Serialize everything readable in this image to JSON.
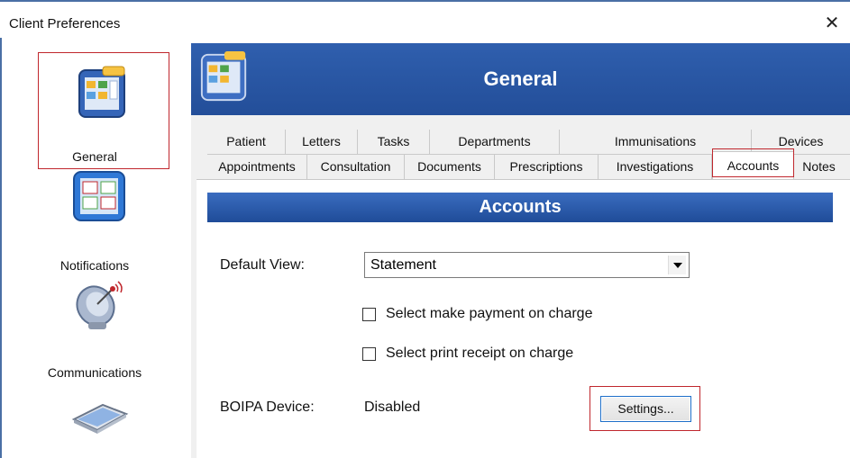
{
  "window": {
    "title": "Client Preferences",
    "close_glyph": "✕"
  },
  "sidebar": {
    "items": [
      {
        "label": "General",
        "icon": "general-app-icon",
        "selected": true
      },
      {
        "label": "Notifications",
        "icon": "notifications-board-icon"
      },
      {
        "label": "Communications",
        "icon": "satellite-dish-icon"
      },
      {
        "label": "",
        "icon": "scanner-icon"
      }
    ]
  },
  "header": {
    "title": "General"
  },
  "tabs": {
    "row1": [
      "Patient",
      "Letters",
      "Tasks",
      "Departments",
      "Immunisations",
      "Devices"
    ],
    "row2": [
      "Appointments",
      "Consultation",
      "Documents",
      "Prescriptions",
      "Investigations",
      "Accounts",
      "Notes"
    ],
    "active": "Accounts"
  },
  "accounts": {
    "title": "Accounts",
    "default_view_label": "Default View:",
    "default_view_value": "Statement",
    "chk_payment_label": "Select make payment on charge",
    "chk_payment_checked": false,
    "chk_receipt_label": "Select print receipt on charge",
    "chk_receipt_checked": false,
    "boipa_label": "BOIPA Device:",
    "boipa_value": "Disabled",
    "settings_label": "Settings..."
  },
  "colors": {
    "header_blue": "#2f5fae",
    "highlight_red": "#c0272d",
    "focus_blue": "#1e6fc9"
  }
}
